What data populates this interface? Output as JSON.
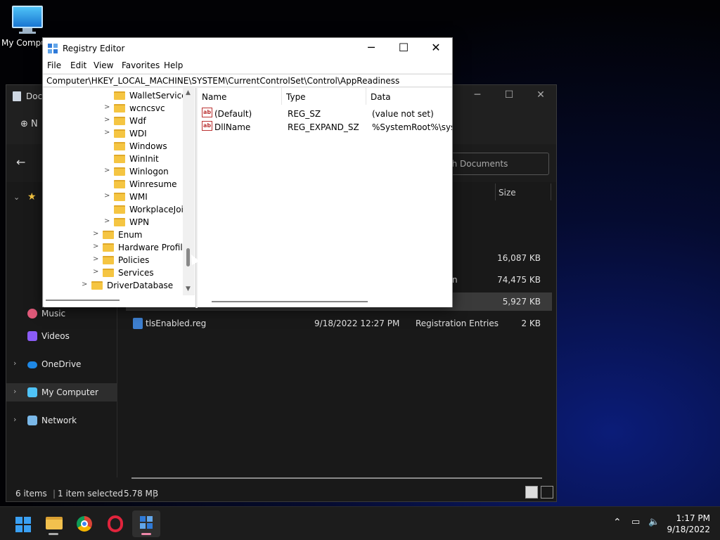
{
  "desktop": {
    "icon_label": "My Computer"
  },
  "explorer": {
    "title": "Docu",
    "new_label": "N",
    "search_placeholder": "ch Documents",
    "column_size": "Size",
    "nav": [
      {
        "label": "Music",
        "icon": "music-icon"
      },
      {
        "label": "Videos",
        "icon": "videos-icon"
      },
      {
        "label": "OneDrive",
        "icon": "cloud-icon"
      },
      {
        "label": "My Computer",
        "icon": "computer-icon"
      },
      {
        "label": "Network",
        "icon": "network-icon"
      }
    ],
    "files": [
      {
        "name": "",
        "date": "",
        "type": "",
        "size": "16,087 KB"
      },
      {
        "name": "",
        "date": "",
        "type": "n",
        "size": "74,475 KB"
      },
      {
        "name": "",
        "date": "",
        "type": "",
        "size": "5,927 KB"
      },
      {
        "name": "tlsEnabled.reg",
        "date": "9/18/2022 12:27 PM",
        "type": "Registration Entries",
        "size": "2 KB"
      }
    ],
    "status": {
      "items": "6 items",
      "selected": "1 item selected",
      "size": "5.78 MB"
    }
  },
  "regedit": {
    "title": "Registry Editor",
    "menu": [
      "File",
      "Edit",
      "View",
      "Favorites",
      "Help"
    ],
    "address": "Computer\\HKEY_LOCAL_MACHINE\\SYSTEM\\CurrentControlSet\\Control\\AppReadiness",
    "tree": [
      {
        "label": "WalletService",
        "expand": ""
      },
      {
        "label": "wcncsvc",
        "expand": ">"
      },
      {
        "label": "Wdf",
        "expand": ">"
      },
      {
        "label": "WDI",
        "expand": ">"
      },
      {
        "label": "Windows",
        "expand": ""
      },
      {
        "label": "WinInit",
        "expand": ""
      },
      {
        "label": "Winlogon",
        "expand": ">"
      },
      {
        "label": "Winresume",
        "expand": ""
      },
      {
        "label": "WMI",
        "expand": ">"
      },
      {
        "label": "WorkplaceJoin",
        "expand": ""
      },
      {
        "label": "WPN",
        "expand": ">"
      },
      {
        "label": "Enum",
        "expand": ">"
      },
      {
        "label": "Hardware Profiles",
        "expand": ">"
      },
      {
        "label": "Policies",
        "expand": ">"
      },
      {
        "label": "Services",
        "expand": ">"
      },
      {
        "label": "DriverDatabase",
        "expand": ">"
      }
    ],
    "columns": {
      "name": "Name",
      "type": "Type",
      "data": "Data"
    },
    "values": [
      {
        "name": "(Default)",
        "type": "REG_SZ",
        "data": "(value not set)"
      },
      {
        "name": "DllName",
        "type": "REG_EXPAND_SZ",
        "data": "%SystemRoot%\\syste"
      }
    ]
  },
  "taskbar": {
    "apps": [
      {
        "icon": "windows-start-icon"
      },
      {
        "icon": "file-explorer-icon"
      },
      {
        "icon": "chrome-icon"
      },
      {
        "icon": "opera-icon"
      },
      {
        "icon": "registry-editor-icon"
      }
    ],
    "time": "1:17 PM",
    "date": "9/18/2022"
  }
}
